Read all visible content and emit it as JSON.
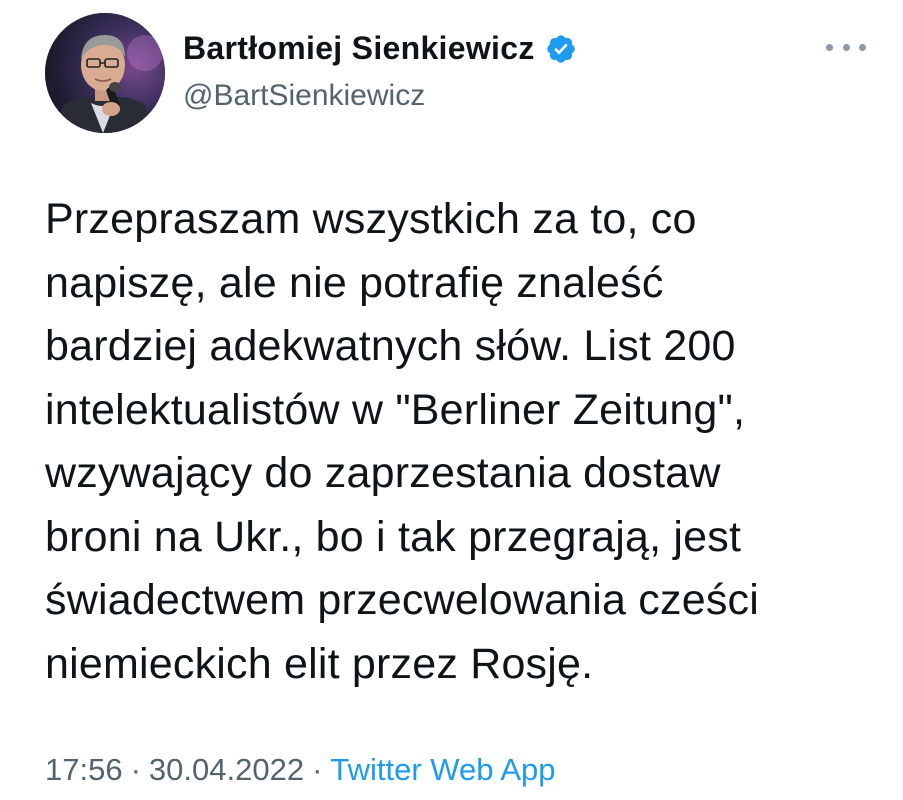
{
  "author": {
    "display_name": "Bartłomiej Sienkiewicz",
    "handle": "@BartSienkiewicz",
    "verified": true,
    "verified_color": "#1d9bf0"
  },
  "tweet": {
    "lines": [
      "Przepraszam wszystkich za to, co",
      "napiszę, ale nie potrafię znaleść",
      "bardziej adekwatnych słów. List 200",
      "intelektualistów w \"Berliner Zeitung\",",
      "wzywający do zaprzestania dostaw",
      "broni na Ukr., bo i tak przegrają, jest",
      "świadectwem przecwelowania cześci",
      "niemieckich elit przez Rosję."
    ]
  },
  "meta": {
    "time": "17:56",
    "date": "30.04.2022",
    "separator": "·",
    "source": "Twitter Web App"
  },
  "icons": {
    "more": "more-options-icon",
    "verified": "verified-badge-icon"
  }
}
